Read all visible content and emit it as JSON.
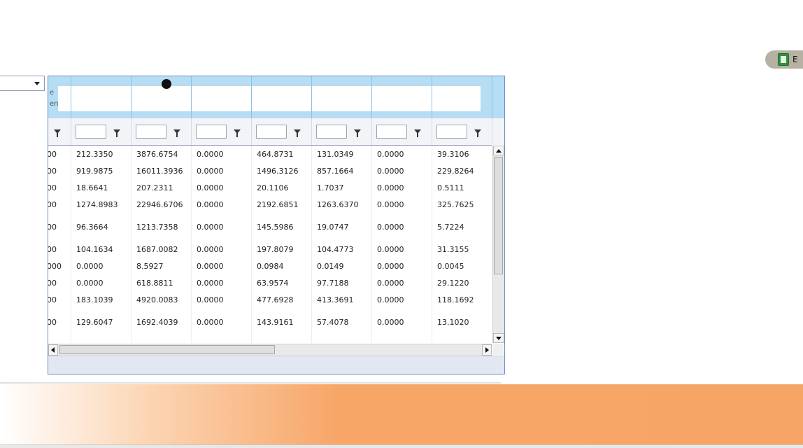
{
  "toolbar": {
    "export_label": "E",
    "export_icon": "excel-icon"
  },
  "filter": {
    "dropdown_value": ""
  },
  "grid": {
    "header_hints": [
      "e",
      "en"
    ],
    "rows": [
      [
        "00",
        "212.3350",
        "3876.6754",
        "0.0000",
        "464.8731",
        "131.0349",
        "0.0000",
        "39.3106"
      ],
      [
        "00",
        "919.9875",
        "16011.3936",
        "0.0000",
        "1496.3126",
        "857.1664",
        "0.0000",
        "229.8264"
      ],
      [
        "00",
        "18.6641",
        "207.2311",
        "0.0000",
        "20.1106",
        "1.7037",
        "0.0000",
        "0.5111"
      ],
      [
        "00",
        "1274.8983",
        "22946.6706",
        "0.0000",
        "2192.6851",
        "1263.6370",
        "0.0000",
        "325.7625"
      ],
      [
        "00",
        "96.3664",
        "1213.7358",
        "0.0000",
        "145.5986",
        "19.0747",
        "0.0000",
        "5.7224"
      ],
      [
        "00",
        "104.1634",
        "1687.0082",
        "0.0000",
        "197.8079",
        "104.4773",
        "0.0000",
        "31.3155"
      ],
      [
        "000",
        "0.0000",
        "8.5927",
        "0.0000",
        "0.0984",
        "0.0149",
        "0.0000",
        "0.0045"
      ],
      [
        "00",
        "0.0000",
        "618.8811",
        "0.0000",
        "63.9574",
        "97.7188",
        "0.0000",
        "29.1220"
      ],
      [
        "00",
        "183.1039",
        "4920.0083",
        "0.0000",
        "477.6928",
        "413.3691",
        "0.0000",
        "118.1692"
      ],
      [
        "00",
        "129.6047",
        "1692.4039",
        "0.0000",
        "143.9161",
        "57.4078",
        "0.0000",
        "13.1020"
      ]
    ]
  },
  "colors": {
    "header_band": "#b6ddf3",
    "grid_border": "#6b8fc5",
    "orange_band": "#f7a567"
  }
}
